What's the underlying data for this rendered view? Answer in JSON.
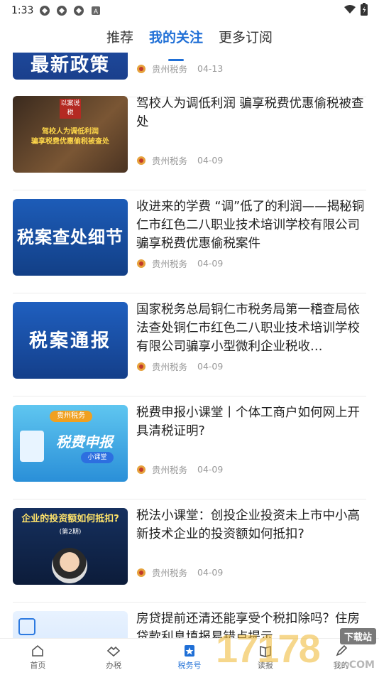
{
  "status_bar": {
    "time": "1:33"
  },
  "tabs": [
    {
      "label": "推荐"
    },
    {
      "label": "我的关注",
      "active": true
    },
    {
      "label": "更多订阅"
    }
  ],
  "feed": {
    "items": [
      {
        "thumb_text": "最新政策",
        "title": "",
        "source": "贵州税务",
        "date": "04-13"
      },
      {
        "thumb_text": "驾校人为调低利润\n骗享税费优惠偷税被查处",
        "thumb_badge": "以案说税",
        "title": "驾校人为调低利润 骗享税费优惠偷税被查处",
        "source": "贵州税务",
        "date": "04-09"
      },
      {
        "thumb_text": "税案查处细节",
        "title": "收进来的学费 “调”低了的利润——揭秘铜仁市红色二八职业技术培训学校有限公司骗享税费优惠偷税案件",
        "source": "贵州税务",
        "date": "04-09"
      },
      {
        "thumb_text": "税案通报",
        "title": "国家税务总局铜仁市税务局第一稽查局依法查处铜仁市红色二八职业技术培训学校有限公司骗享小型微利企业税收…",
        "source": "贵州税务",
        "date": "04-09"
      },
      {
        "thumb_text": "税费申报",
        "thumb_badge": "贵州税务",
        "thumb_sub": "小课堂",
        "title": "税费申报小课堂丨个体工商户如何网上开具清税证明?",
        "source": "贵州税务",
        "date": "04-09"
      },
      {
        "thumb_text": "企业的投资额如何抵扣?",
        "thumb_sub": "(第2期)",
        "title": "税法小课堂：创投企业投资未上市中小高新技术企业的投资额如何抵扣?",
        "source": "贵州税务",
        "date": "04-09"
      },
      {
        "thumb_text": "",
        "title": "房贷提前还清还能享受个税扣除吗？住房贷款利息填报易错点提示",
        "source": "",
        "date": ""
      }
    ]
  },
  "bottom_nav": [
    {
      "label": "首页",
      "icon": "home-icon"
    },
    {
      "label": "办税",
      "icon": "handshake-icon"
    },
    {
      "label": "税务号",
      "icon": "star-badge-icon",
      "active": true
    },
    {
      "label": "读报",
      "icon": "book-icon"
    },
    {
      "label": "我的",
      "icon": "pen-icon"
    }
  ],
  "watermark": {
    "text": "17178",
    "sub": "下载站",
    "domain": ".COM"
  },
  "colors": {
    "accent": "#1f6fd6",
    "thumb_blue": "#1a4fa0"
  }
}
